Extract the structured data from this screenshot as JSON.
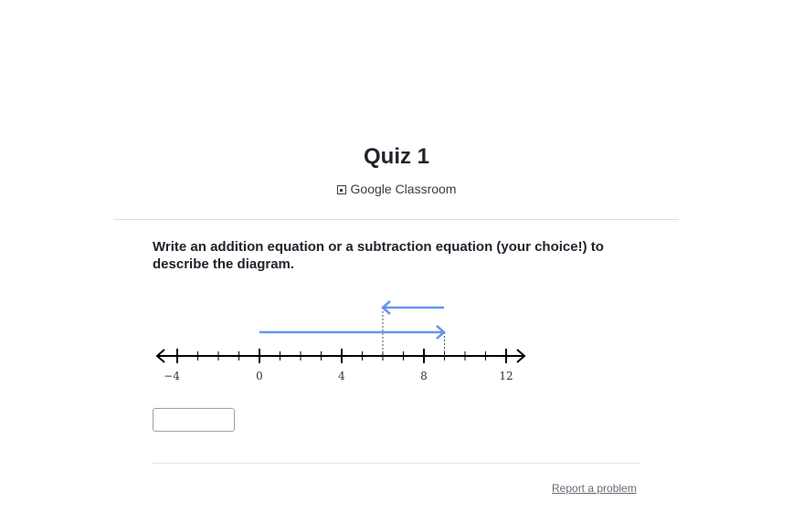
{
  "header": {
    "title": "Quiz 1",
    "source_label": "Google Classroom",
    "source_icon": "google-classroom-icon"
  },
  "question": {
    "prompt": "Write an addition equation or a subtraction equation (your choice!) to describe the diagram."
  },
  "number_line": {
    "min": -4,
    "max": 12,
    "labeled_ticks": [
      "−4",
      "0",
      "4",
      "8",
      "12"
    ],
    "arrows": [
      {
        "from": 0,
        "to": 9,
        "direction": "right",
        "color": "#6495ed"
      },
      {
        "from": 9,
        "to": 6,
        "direction": "left",
        "color": "#6495ed"
      }
    ]
  },
  "answer": {
    "value": "",
    "placeholder": ""
  },
  "footer": {
    "report_label": "Report a problem"
  }
}
